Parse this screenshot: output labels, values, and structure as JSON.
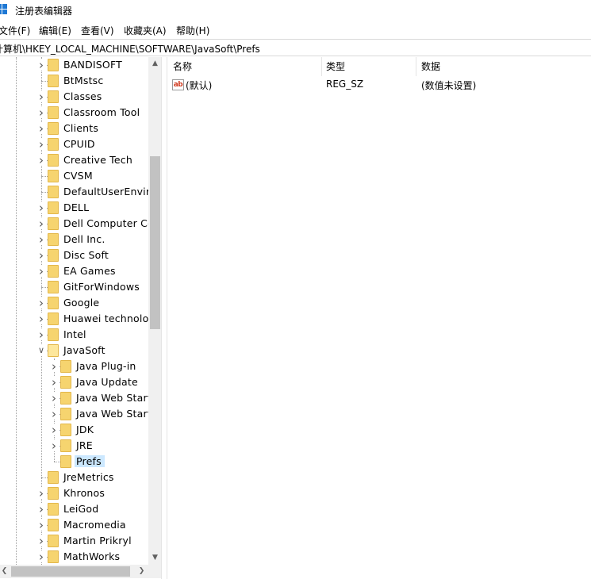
{
  "window": {
    "title": "注册表编辑器"
  },
  "menu": [
    {
      "label": "文件(F)"
    },
    {
      "label": "编辑(E)"
    },
    {
      "label": "查看(V)"
    },
    {
      "label": "收藏夹(A)"
    },
    {
      "label": "帮助(H)"
    }
  ],
  "address": {
    "path": "计算机\\HKEY_LOCAL_MACHINE\\SOFTWARE\\JavaSoft\\Prefs"
  },
  "tree": {
    "items": [
      {
        "label": "BANDISOFT",
        "level": 1,
        "expander": "collapsed"
      },
      {
        "label": "BtMstsc",
        "level": 1,
        "expander": "none"
      },
      {
        "label": "Classes",
        "level": 1,
        "expander": "collapsed"
      },
      {
        "label": "Classroom Tool",
        "level": 1,
        "expander": "collapsed"
      },
      {
        "label": "Clients",
        "level": 1,
        "expander": "collapsed"
      },
      {
        "label": "CPUID",
        "level": 1,
        "expander": "collapsed"
      },
      {
        "label": "Creative Tech",
        "level": 1,
        "expander": "collapsed"
      },
      {
        "label": "CVSM",
        "level": 1,
        "expander": "none"
      },
      {
        "label": "DefaultUserEnviron",
        "level": 1,
        "expander": "none"
      },
      {
        "label": "DELL",
        "level": 1,
        "expander": "collapsed"
      },
      {
        "label": "Dell Computer Cor",
        "level": 1,
        "expander": "collapsed"
      },
      {
        "label": "Dell Inc.",
        "level": 1,
        "expander": "collapsed"
      },
      {
        "label": "Disc Soft",
        "level": 1,
        "expander": "collapsed"
      },
      {
        "label": "EA Games",
        "level": 1,
        "expander": "collapsed"
      },
      {
        "label": "GitForWindows",
        "level": 1,
        "expander": "none"
      },
      {
        "label": "Google",
        "level": 1,
        "expander": "collapsed"
      },
      {
        "label": "Huawei technologi",
        "level": 1,
        "expander": "collapsed"
      },
      {
        "label": "Intel",
        "level": 1,
        "expander": "collapsed"
      },
      {
        "label": "JavaSoft",
        "level": 1,
        "expander": "expanded"
      },
      {
        "label": "Java Plug-in",
        "level": 2,
        "expander": "collapsed"
      },
      {
        "label": "Java Update",
        "level": 2,
        "expander": "collapsed"
      },
      {
        "label": "Java Web Start",
        "level": 2,
        "expander": "collapsed"
      },
      {
        "label": "Java Web Start",
        "level": 2,
        "expander": "collapsed"
      },
      {
        "label": "JDK",
        "level": 2,
        "expander": "collapsed"
      },
      {
        "label": "JRE",
        "level": 2,
        "expander": "collapsed"
      },
      {
        "label": "Prefs",
        "level": 2,
        "expander": "none",
        "selected": true
      },
      {
        "label": "JreMetrics",
        "level": 1,
        "expander": "none"
      },
      {
        "label": "Khronos",
        "level": 1,
        "expander": "collapsed"
      },
      {
        "label": "LeiGod",
        "level": 1,
        "expander": "collapsed"
      },
      {
        "label": "Macromedia",
        "level": 1,
        "expander": "collapsed"
      },
      {
        "label": "Martin Prikryl",
        "level": 1,
        "expander": "collapsed"
      },
      {
        "label": "MathWorks",
        "level": 1,
        "expander": "collapsed"
      }
    ]
  },
  "list": {
    "columns": [
      "名称",
      "类型",
      "数据"
    ],
    "rows": [
      {
        "icon": "string-value-icon",
        "icon_text": "ab",
        "name": "(默认)",
        "type": "REG_SZ",
        "data": "(数值未设置)"
      }
    ]
  },
  "colors": {
    "selection": "#cce8ff",
    "folder": "#f6d46f",
    "accent": "#1e78d4"
  }
}
